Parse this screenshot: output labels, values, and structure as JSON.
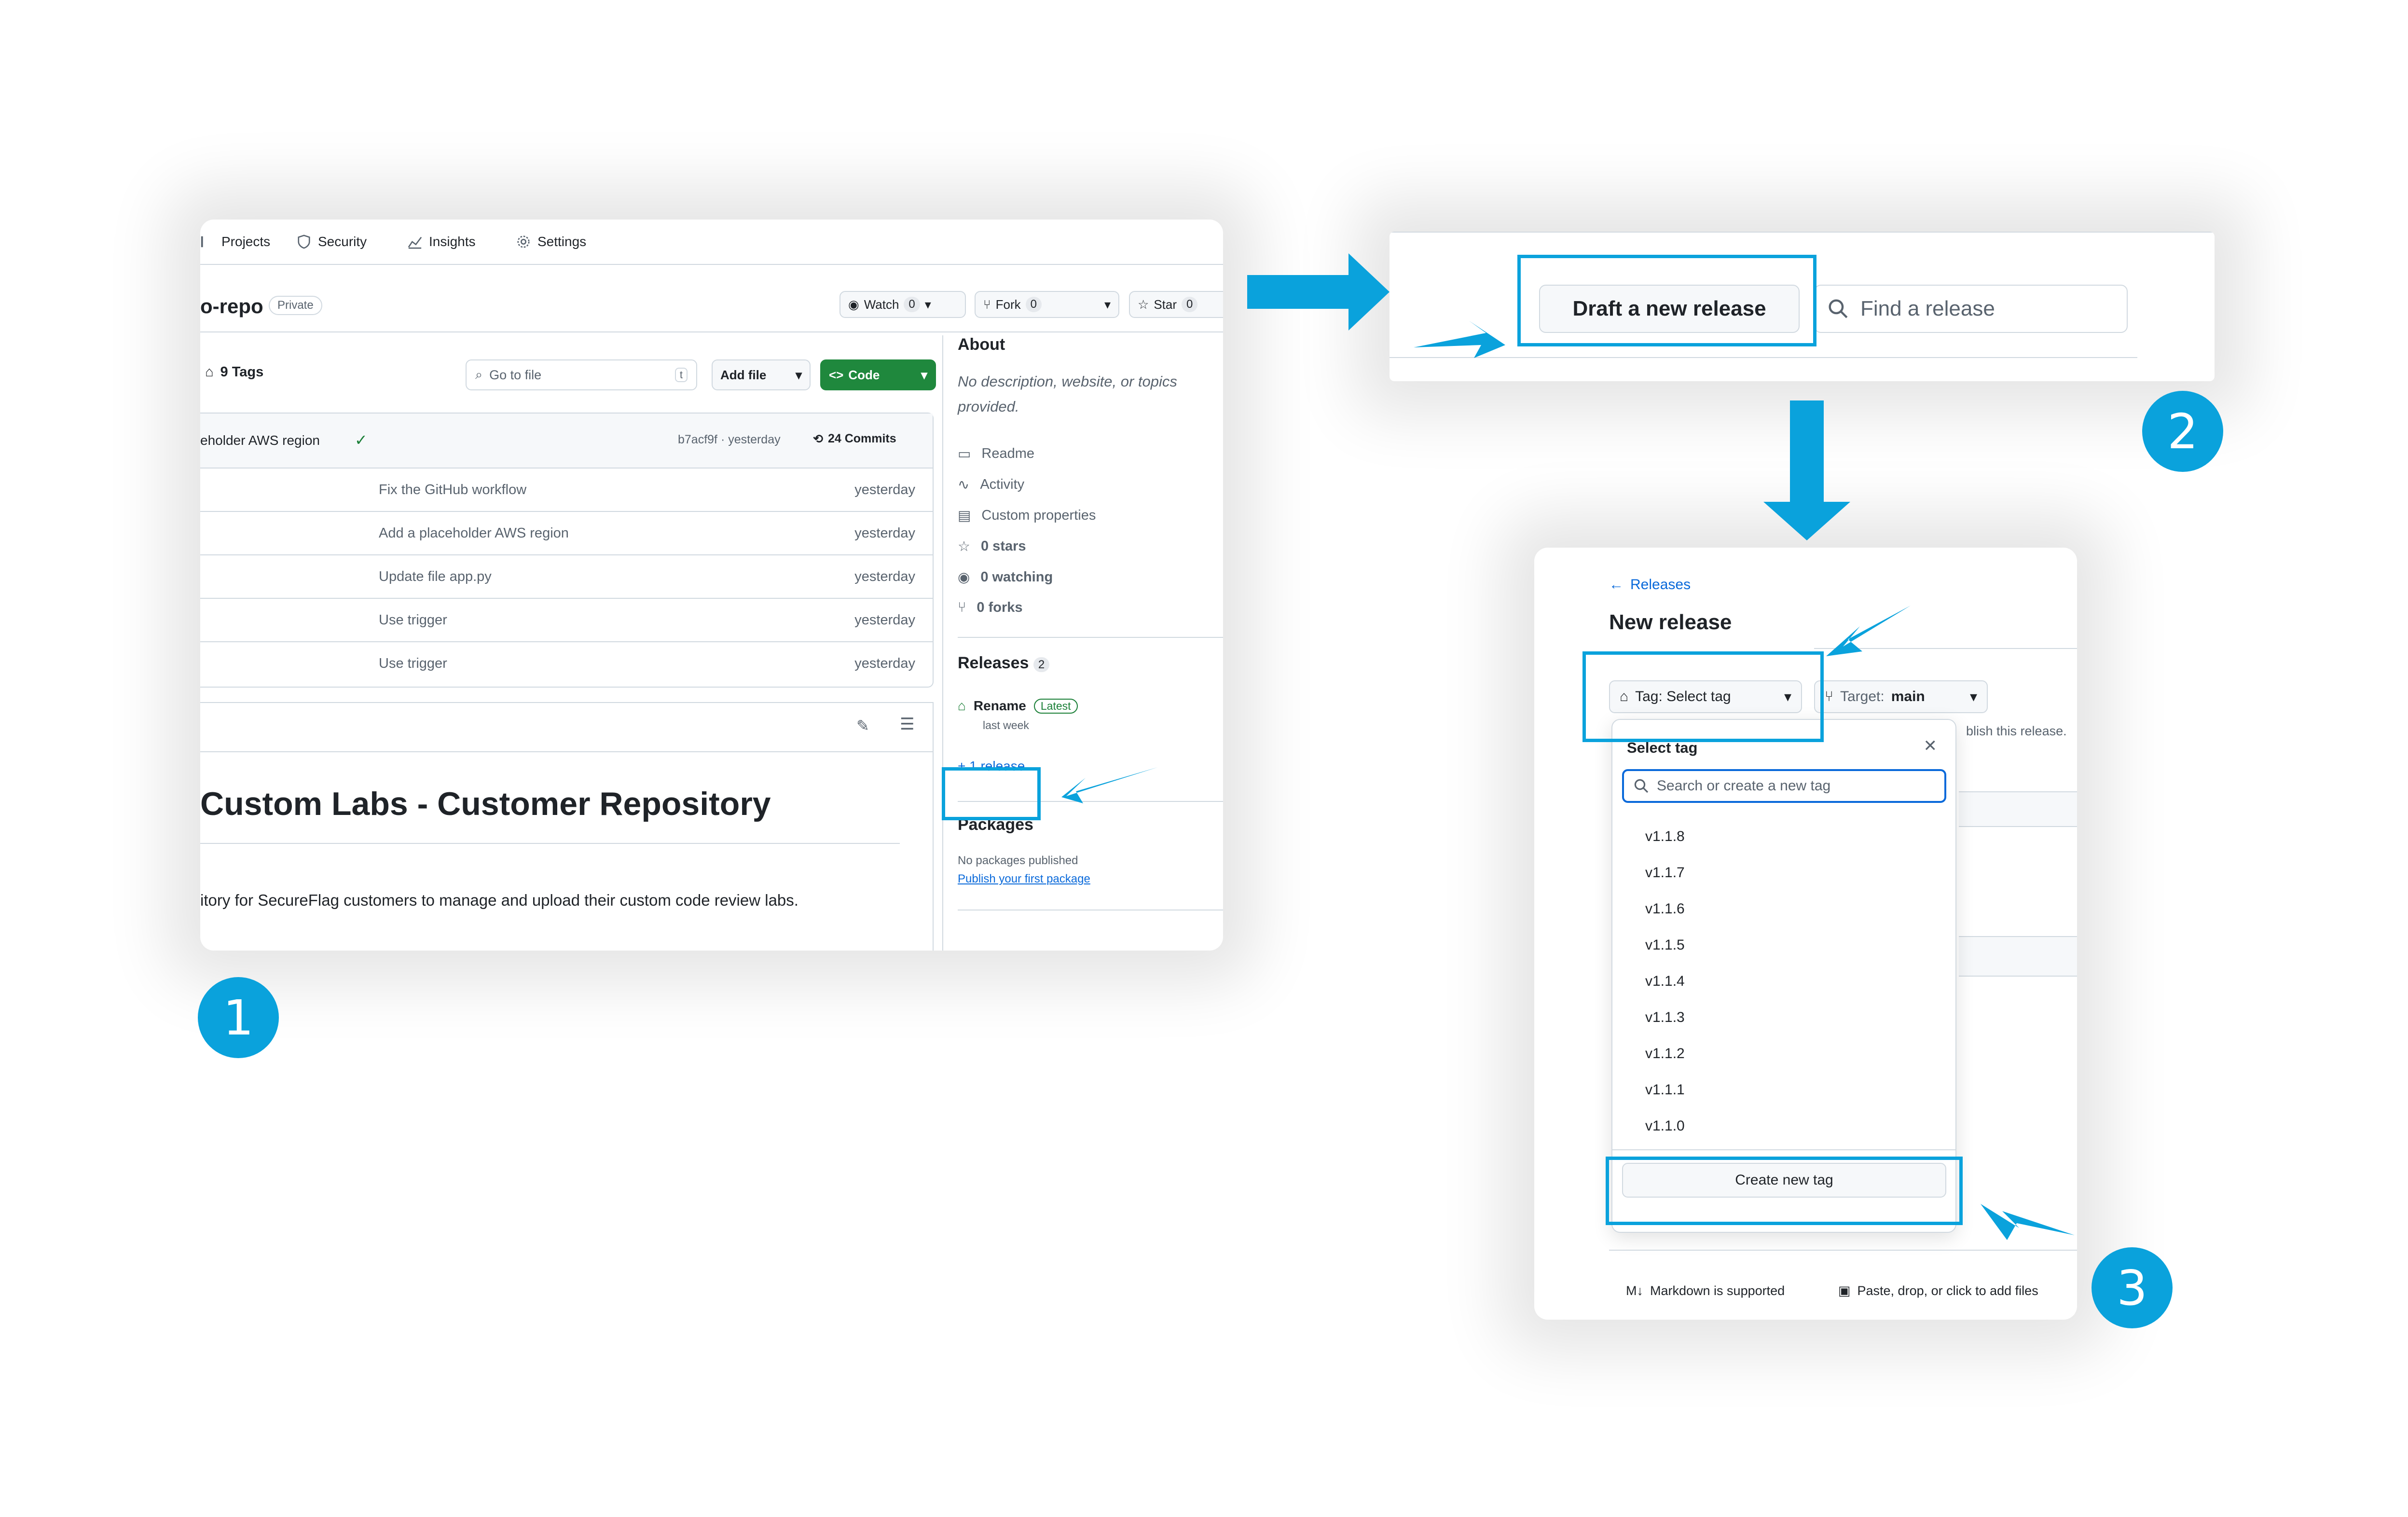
{
  "step_numbers": [
    "1",
    "2",
    "3"
  ],
  "accent_color": "#0aa2dc",
  "panel1": {
    "nav": {
      "projects": "Projects",
      "security": "Security",
      "insights": "Insights",
      "settings": "Settings"
    },
    "repo": {
      "name": "o-repo",
      "visibility": "Private",
      "watch_label": "Watch",
      "watch_count": "0",
      "fork_label": "Fork",
      "fork_count": "0",
      "star_label": "Star",
      "star_count": "0"
    },
    "toolbar": {
      "tags": "9 Tags",
      "go_to_file_placeholder": "Go to file",
      "go_to_file_shortcut": "t",
      "add_file": "Add file",
      "code": "Code"
    },
    "latest_commit": {
      "message": "eholder AWS region",
      "hash_time": "b7acf9f · yesterday",
      "commits": "24 Commits"
    },
    "files": [
      {
        "message": "Fix the GitHub workflow",
        "date": "yesterday"
      },
      {
        "message": "Add a placeholder AWS region",
        "date": "yesterday"
      },
      {
        "message": "Update file app.py",
        "date": "yesterday"
      },
      {
        "message": "Use trigger",
        "date": "yesterday"
      },
      {
        "message": "Use trigger",
        "date": "yesterday"
      }
    ],
    "readme": {
      "title": "Custom Labs - Customer Repository",
      "body": "itory for SecureFlag customers to manage and upload their custom code review labs."
    },
    "about": {
      "heading": "About",
      "description": "No description, website, or topics provided.",
      "items": [
        "Readme",
        "Activity",
        "Custom properties",
        "0 stars",
        "0 watching",
        "0 forks"
      ]
    },
    "releases": {
      "heading": "Releases",
      "count": "2",
      "latest_name": "Rename",
      "latest_badge": "Latest",
      "latest_time": "last week",
      "more_link": "+ 1 release"
    },
    "packages": {
      "heading": "Packages",
      "none": "No packages published",
      "publish_link": "Publish your first package"
    }
  },
  "panel2": {
    "draft_button": "Draft a new release",
    "find_placeholder": "Find a release"
  },
  "panel3": {
    "breadcrumb": "Releases",
    "title": "New release",
    "tag_button": "Tag: Select tag",
    "target_label": "Target:",
    "target_value": "main",
    "hint_fragment": "blish this release.",
    "dropdown_title": "Select tag",
    "search_placeholder": "Search or create a new tag",
    "tags": [
      "v1.1.8",
      "v1.1.7",
      "v1.1.6",
      "v1.1.5",
      "v1.1.4",
      "v1.1.3",
      "v1.1.2",
      "v1.1.1",
      "v1.1.0"
    ],
    "create_tag": "Create new tag",
    "markdown_note": "Markdown is supported",
    "attach_note": "Paste, drop, or click to add files"
  }
}
